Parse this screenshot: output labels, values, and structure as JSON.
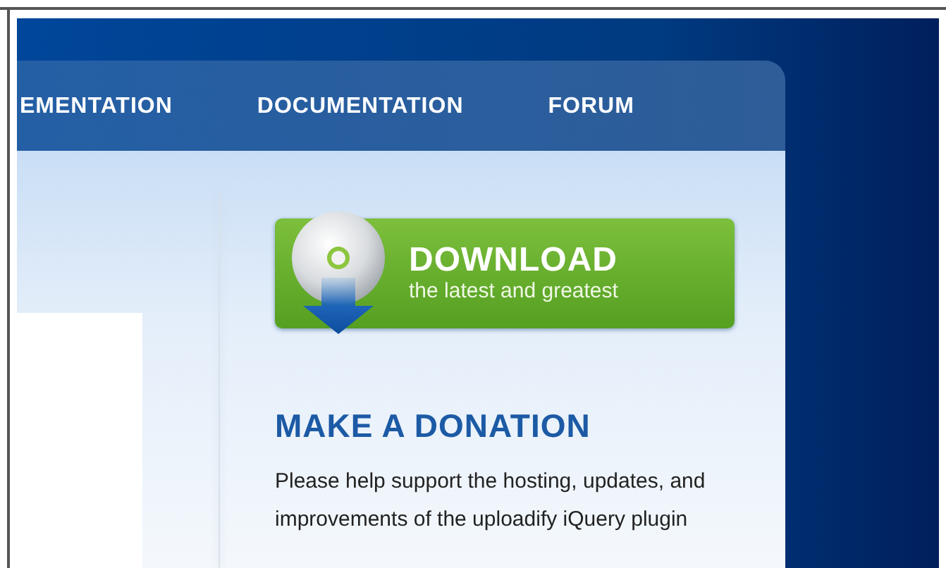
{
  "nav": {
    "items": [
      {
        "label": "EMENTATION"
      },
      {
        "label": "DOCUMENTATION"
      },
      {
        "label": "FORUM"
      }
    ]
  },
  "download_button": {
    "title": "DOWNLOAD",
    "subtitle": "the latest and greatest"
  },
  "donation": {
    "heading": "MAKE A DONATION",
    "text": "Please help support the hosting, updates, and improvements of the uploadify iQuery plugin"
  }
}
